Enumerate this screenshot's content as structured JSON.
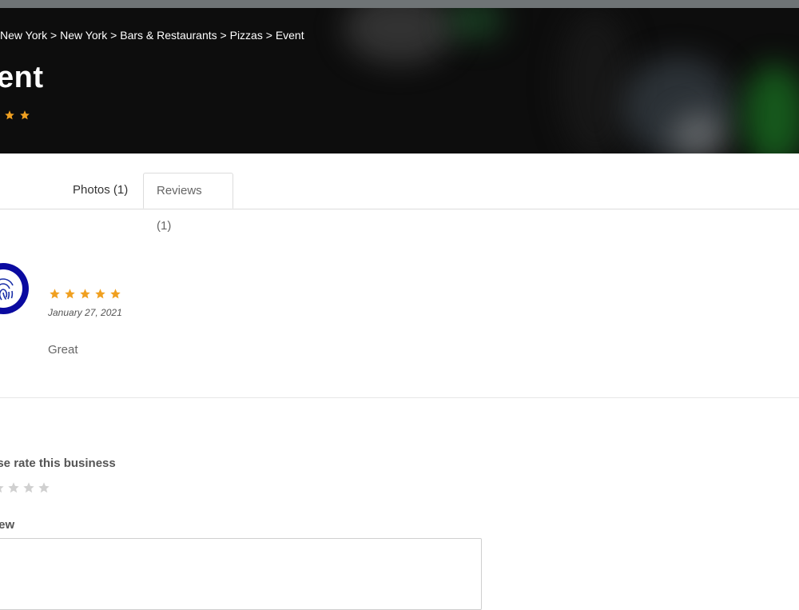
{
  "colors": {
    "hero_background": "#0d0d0d",
    "star_filled": "#f0a020",
    "star_empty": "#d0d0d0",
    "avatar_ring": "#0a0aa0"
  },
  "breadcrumb": [
    "New York",
    ">",
    "New York",
    ">",
    "Bars & Restaurants",
    ">",
    "Pizzas",
    ">",
    "Event"
  ],
  "page": {
    "title": "ent",
    "rating_stars": 2
  },
  "tabs": [
    {
      "label": "Photos (1)",
      "active": false
    },
    {
      "label": "Reviews (1)",
      "active": true
    }
  ],
  "review": {
    "avatar_icon": "fingerprint-icon",
    "rating": 5,
    "date": "January 27, 2021",
    "text": "Great"
  },
  "rate_form": {
    "prompt": "ase rate this business",
    "rating": 0,
    "review_label": "iew",
    "review_placeholder": ""
  }
}
